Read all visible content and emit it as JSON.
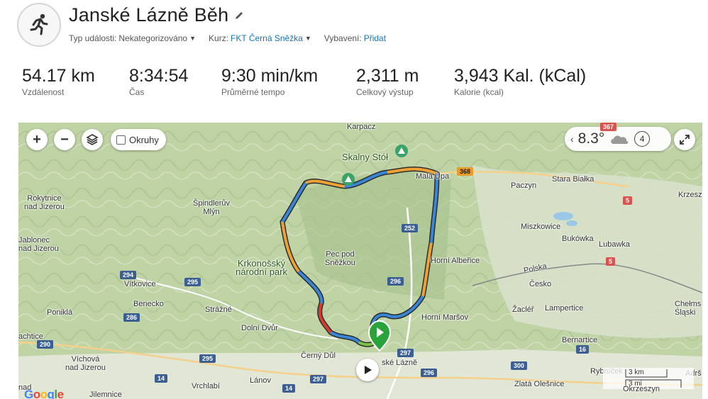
{
  "header": {
    "title": "Janské Lázně Běh",
    "event_type_label": "Typ události:",
    "event_type_value": "Nekategorizováno",
    "course_label": "Kurz:",
    "course_value": "FKT Černá Sněžka",
    "gear_label": "Vybavení:",
    "gear_value": "Přidat"
  },
  "stats": [
    {
      "value": "54.17 km",
      "label": "Vzdálenost"
    },
    {
      "value": "8:34:54",
      "label": "Čas"
    },
    {
      "value": "9:30 min/km",
      "label": "Průměrné tempo"
    },
    {
      "value": "2,311 m",
      "label": "Celkový výstup"
    },
    {
      "value": "3,943 Kal. (kCal)",
      "label": "Kalorie (kcal)"
    }
  ],
  "map": {
    "zoom_in": "+",
    "zoom_out": "−",
    "circles_label": "Okruhy",
    "weather": {
      "temperature": "8.3°",
      "wind": "4"
    },
    "scale": {
      "metric": "3 km",
      "imperial": "3 mi"
    },
    "google": "Google",
    "places": {
      "karpacz": "Karpacz",
      "skalny_stol": "Skalny Stół",
      "mala_upa": "Malá Úpa",
      "paczyn": "Paczyn",
      "stara_bialka": "Stara Białka",
      "krzeszow": "Krzeszó",
      "rokytnice": "Rokytnice\nnad Jizerou",
      "spindleruv": "Špindlerův\nMlýn",
      "jablonec": "Jablonec\nnad Jizerou",
      "miszkowice": "Miszkowice",
      "bukowka": "Bukówka",
      "lubawka": "Lubawka",
      "pec": "Pec pod\nSněžkou",
      "krnap": "Krkonošský\nnárodní park",
      "horni_albeřice": "Horní Albeřice",
      "polska": "Polska",
      "cesko": "Česko",
      "vitkovice": "Vítkovice",
      "benecko": "Benecko",
      "poniklá": "Poniklá",
      "strazne": "Strážné",
      "horni_marsov": "Horní Maršov",
      "zacler": "Žacléř",
      "lampertice": "Lampertice",
      "chelmsko": "Chełms\nŚląski",
      "dolni_dvur": "Dolní Dvůr",
      "bernartice": "Bernartice",
      "vichova": "Víchová\nnad Jizerou",
      "cerny_dul": "Černý Důl",
      "janske_lazne": "ské Lázně",
      "rybnicek": "Rybníček",
      "lanov": "Lánov",
      "vrchlabi": "Vrchlabí",
      "zlata_olesnice": "Zlatá Olešnice",
      "okrzeszyn": "Okrzeszyn",
      "adrspach": "Adrš",
      "jilemnice": "Jilemnice",
      "nad": "nad",
      "achtice": "achtice"
    },
    "roads": {
      "r368": "368",
      "r252": "252",
      "r294": "294",
      "r295a": "295",
      "r296a": "296",
      "r286": "286",
      "r290": "290",
      "r295b": "295",
      "r297": "297",
      "r296b": "296",
      "r300": "300",
      "r16": "16",
      "r14a": "14",
      "r14b": "14",
      "r5a": "5",
      "r5b": "5",
      "r367": "367"
    }
  }
}
